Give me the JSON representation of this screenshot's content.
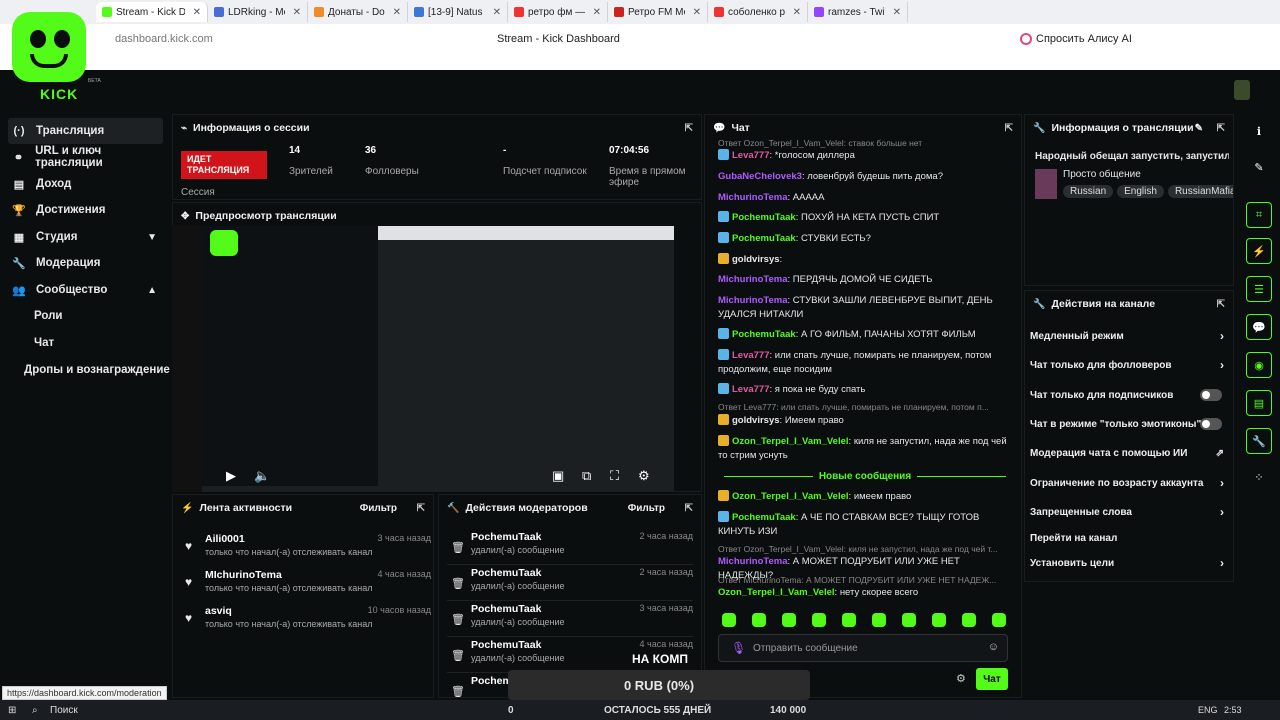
{
  "browser": {
    "tabs": [
      {
        "label": "Stream - Kick Dash",
        "color": "#53fc18",
        "active": true
      },
      {
        "label": "LDRking - Media req",
        "color": "#4a6cd6"
      },
      {
        "label": "Донаты - DonationA",
        "color": "#f08a2a"
      },
      {
        "label": "[13-9] Natus Vincere",
        "color": "#3a7ad6"
      },
      {
        "label": "ретро фм — Яндекс",
        "color": "#e33"
      },
      {
        "label": "Ретро FM Моск",
        "color": "#c22"
      },
      {
        "label": "соболенко рыбакин",
        "color": "#e33"
      },
      {
        "label": "ramzes - Twitch",
        "color": "#9147ff"
      }
    ],
    "url": "dashboard.kick.com",
    "title": "Stream - Kick Dashboard",
    "alice": "Спросить Алису AI"
  },
  "header": {
    "beta": "БЕТА",
    "logo": "KICK"
  },
  "sidebar": {
    "items": [
      {
        "label": "Трансляция",
        "icon": "(·)"
      },
      {
        "label": "URL и ключ трансляции",
        "icon": "⚭"
      },
      {
        "label": "Доход",
        "icon": "▤"
      },
      {
        "label": "Достижения",
        "icon": "🏆"
      },
      {
        "label": "Студия",
        "icon": "▦"
      },
      {
        "label": "Модерация",
        "icon": "🔧"
      },
      {
        "label": "Сообщество",
        "icon": "👥"
      }
    ],
    "sub": [
      "Роли",
      "Чат",
      "Дропы и вознаграждение"
    ]
  },
  "session": {
    "title": "Информация о сессии",
    "live": "ИДЕТ ТРАНСЛЯЦИЯ",
    "live_sub": "Сессия",
    "stats": [
      {
        "value": "14",
        "label": "Зрителей"
      },
      {
        "value": "36",
        "label": "Фолловеры"
      },
      {
        "value": "-",
        "label": "Подсчет подписок"
      },
      {
        "value": "07:04:56",
        "label": "Время в прямом эфире"
      }
    ]
  },
  "preview": {
    "title": "Предпросмотр трансляции"
  },
  "activity": {
    "title": "Лента активности",
    "filter": "Фильтр",
    "items": [
      {
        "name": "Aili0001",
        "desc": "только что начал(-а) отслеживать канал",
        "time": "3 часа назад"
      },
      {
        "name": "MIchurinoTema",
        "desc": "только что начал(-а) отслеживать канал",
        "time": "4 часа назад"
      },
      {
        "name": "asviq",
        "desc": "только что начал(-а) отслеживать канал",
        "time": "10 часов назад"
      }
    ]
  },
  "modactions": {
    "title": "Действия модераторов",
    "filter": "Фильтр",
    "items": [
      {
        "name": "PochemuTaak",
        "desc": "удалил(-а) сообщение",
        "time": "2 часа назад"
      },
      {
        "name": "PochemuTaak",
        "desc": "удалил(-а) сообщение",
        "time": "2 часа назад"
      },
      {
        "name": "PochemuTaak",
        "desc": "удалил(-а) сообщение",
        "time": "3 часа назад"
      },
      {
        "name": "PochemuTaak",
        "desc": "удалил(-а) сообщение",
        "time": "4 часа назад"
      },
      {
        "name": "Pochem",
        "desc": "",
        "time": ""
      }
    ],
    "overlay": "НА КОМП"
  },
  "chat": {
    "title": "Чат",
    "reply_top": "Ответ Ozon_Terpel_I_Vam_Velel: ставок больше нет",
    "messages": [
      {
        "name": "Leva777",
        "color": "#e05aa8",
        "text": "*голосом диллера",
        "badge": "mod"
      },
      {
        "name": "GubaNeChelovek3",
        "color": "#b05aff",
        "text": "ловенбруй будешь пить дома?",
        "badge": ""
      },
      {
        "name": "MichurinoTema",
        "color": "#b05aff",
        "text": "ААААА",
        "badge": ""
      },
      {
        "name": "PochemuTaak",
        "color": "#53fc18",
        "text": "ПОХУЙ НА КЕТА ПУСТЬ СПИТ",
        "badge": "mod"
      },
      {
        "name": "PochemuTaak",
        "color": "#53fc18",
        "text": "СТУВКИ ЕСТЬ?",
        "badge": "mod"
      },
      {
        "name": "goldvirsys",
        "color": "#e8e8e8",
        "text": "",
        "badge": "crown"
      },
      {
        "name": "MichurinoTema",
        "color": "#b05aff",
        "text": "ПЕРДЯЧЬ ДОМОЙ ЧЕ СИДЕТЬ",
        "badge": ""
      },
      {
        "name": "MichurinoTema",
        "color": "#b05aff",
        "text": "СТУВКИ ЗАШЛИ ЛЕВЕНБРУЕ ВЫПИТ, ДЕНЬ УДАЛСЯ НИТАКЛИ",
        "badge": ""
      },
      {
        "name": "PochemuTaak",
        "color": "#53fc18",
        "text": "А ГО ФИЛЬМ, ПАЧАНЫ ХОТЯТ ФИЛЬМ",
        "badge": "mod"
      },
      {
        "name": "Leva777",
        "color": "#e05aa8",
        "text": "или спать лучше, помирать не планируем, потом продолжим, еще посидим",
        "badge": "mod"
      },
      {
        "name": "Leva777",
        "color": "#e05aa8",
        "text": "я пока не буду спать",
        "badge": "mod"
      }
    ],
    "reply2": "Ответ Leva777: или спать лучше, помирать не планируем, потом п...",
    "messages2": [
      {
        "name": "goldvirsys",
        "color": "#e8e8e8",
        "text": "Имеем право",
        "badge": "crown"
      },
      {
        "name": "Ozon_Terpel_I_Vam_Velel",
        "color": "#53fc18",
        "text": "киля не запустил, нада же под чей то стрим уснуть",
        "badge": "crown"
      }
    ],
    "new_messages": "Новые сообщения",
    "messages3": [
      {
        "name": "Ozon_Terpel_I_Vam_Velel",
        "color": "#53fc18",
        "text": "имеем право",
        "badge": "crown"
      },
      {
        "name": "PochemuTaak",
        "color": "#53fc18",
        "text": "А ЧЕ ПО СТАВКАМ ВСЕ? ТЫЩУ ГОТОВ КИНУТЬ ИЗИ",
        "badge": "mod"
      }
    ],
    "reply3": "Ответ Ozon_Terpel_I_Vam_Velel: киля не запустил, нада же под чей т...",
    "msg4": {
      "name": "MichurinoTema",
      "color": "#b05aff",
      "text": "А МОЖЕТ ПОДРУБИТ ИЛИ УЖЕ НЕТ НАДЕЖДЫ?"
    },
    "reply4": "Ответ MichurinoTema: А МОЖЕТ ПОДРУБИТ ИЛИ УЖЕ НЕТ НАДЕЖ...",
    "msg5": {
      "name": "Ozon_Terpel_I_Vam_Velel",
      "color": "#53fc18",
      "text": "нету скорее всего"
    },
    "placeholder": "Отправить сообщение",
    "send": "Чат"
  },
  "streaminfo": {
    "title": "Информация о трансляции",
    "stream_title": "Народный обещал запустить, запустил",
    "category": "Просто общение",
    "tags": [
      "Russian",
      "English",
      "RussianMafia"
    ]
  },
  "channel": {
    "title": "Действия на канале",
    "rows": [
      {
        "label": "Медленный режим",
        "kind": "arrow"
      },
      {
        "label": "Чат только для фолловеров",
        "kind": "arrow"
      },
      {
        "label": "Чат только для подписчиков",
        "kind": "toggle"
      },
      {
        "label": "Чат в режиме \"только эмотиконы\"",
        "kind": "toggle"
      },
      {
        "label": "Модерация чата с помощью ИИ",
        "kind": "ext"
      },
      {
        "label": "Ограничение по возрасту аккаунта",
        "kind": "arrow"
      },
      {
        "label": "Запрещенные слова",
        "kind": "arrow"
      },
      {
        "label": "Перейти на канал",
        "kind": "none"
      },
      {
        "label": "Установить цели",
        "kind": "arrow"
      }
    ]
  },
  "goal": {
    "text": "0 RUB (0%)",
    "left": "0",
    "remain": "ОСТАЛОСЬ 555 ДНЕЙ",
    "target": "140 000"
  },
  "taskbar": {
    "search": "Поиск",
    "lang": "ENG",
    "time": "2:53"
  },
  "status_url": "https://dashboard.kick.com/moderation"
}
